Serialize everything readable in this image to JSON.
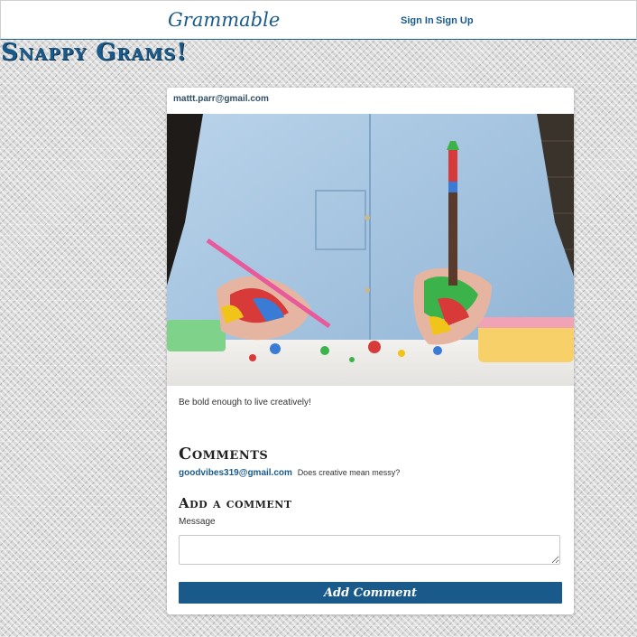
{
  "navbar": {
    "brand": "Grammable",
    "links": [
      {
        "label": "Sign In"
      },
      {
        "label": "Sign Up"
      }
    ]
  },
  "page": {
    "title": "Snappy Grams!"
  },
  "post": {
    "author": "mattt.parr@gmail.com",
    "caption": "Be bold enough to live creatively!",
    "comments_heading": "Comments",
    "comments": [
      {
        "author": "goodvibes319@gmail.com",
        "text": "Does creative mean messy?"
      }
    ],
    "add_comment": {
      "heading": "Add a comment",
      "field_label": "Message",
      "message_value": "",
      "submit_label": "Add Comment"
    }
  },
  "colors": {
    "brand_blue": "#1a5a8a",
    "card_bg": "#ffffff"
  }
}
